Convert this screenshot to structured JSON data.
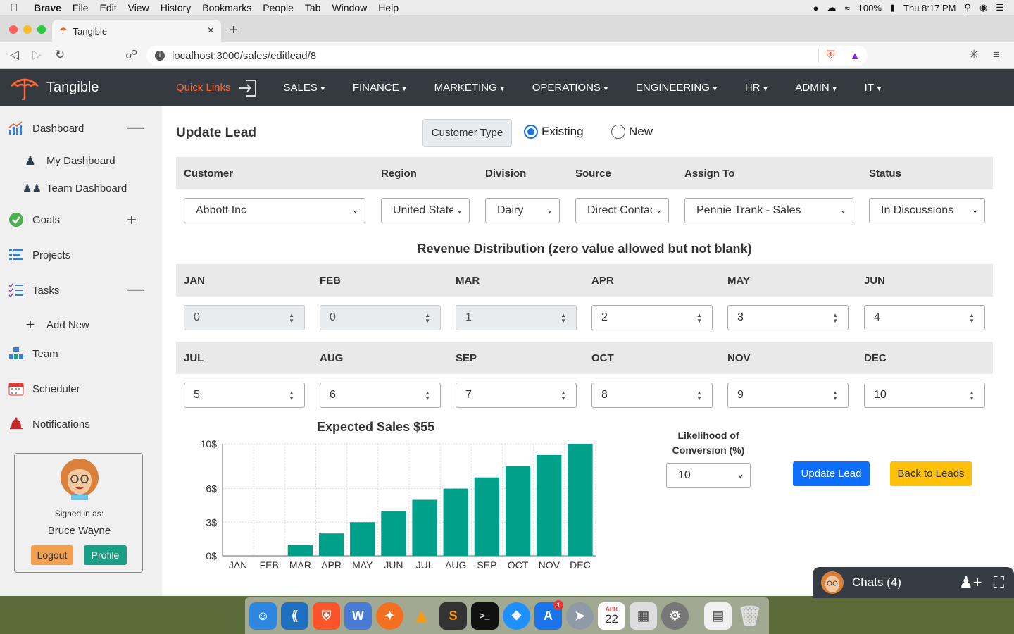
{
  "menubar": {
    "app": "Brave",
    "items": [
      "File",
      "Edit",
      "View",
      "History",
      "Bookmarks",
      "People",
      "Tab",
      "Window",
      "Help"
    ],
    "battery": "100%",
    "clock": "Thu 8:17 PM"
  },
  "browser": {
    "tab_title": "Tangible",
    "url": "localhost:3000/sales/editlead/8"
  },
  "navbar": {
    "brand": "Tangible",
    "quick_links": "Quick Links",
    "links": [
      "SALES",
      "FINANCE",
      "MARKETING",
      "OPERATIONS",
      "ENGINEERING",
      "HR",
      "ADMIN",
      "IT"
    ]
  },
  "sidebar": {
    "dashboard": "Dashboard",
    "my_dashboard": "My Dashboard",
    "team_dashboard": "Team Dashboard",
    "goals": "Goals",
    "projects": "Projects",
    "tasks": "Tasks",
    "add_new": "Add New",
    "team": "Team",
    "scheduler": "Scheduler",
    "notifications": "Notifications",
    "signed_in_as": "Signed in as:",
    "username": "Bruce Wayne",
    "logout": "Logout",
    "profile": "Profile"
  },
  "form": {
    "title": "Update Lead",
    "customer_type_label": "Customer Type",
    "radio_existing": "Existing",
    "radio_new": "New",
    "selected_type": "Existing",
    "headers": {
      "customer": "Customer",
      "region": "Region",
      "division": "Division",
      "source": "Source",
      "assign_to": "Assign To",
      "status": "Status"
    },
    "values": {
      "customer": "Abbott Inc",
      "region": "United States",
      "division": "Dairy",
      "source": "Direct Contact",
      "assign_to": "Pennie Trank - Sales",
      "status": "In Discussions"
    },
    "revenue_title": "Revenue Distribution (zero value allowed but not blank)",
    "months": [
      "JAN",
      "FEB",
      "MAR",
      "APR",
      "MAY",
      "JUN",
      "JUL",
      "AUG",
      "SEP",
      "OCT",
      "NOV",
      "DEC"
    ],
    "revenue": [
      "0",
      "0",
      "1",
      "2",
      "3",
      "4",
      "5",
      "6",
      "7",
      "8",
      "9",
      "10"
    ],
    "likelihood_label_1": "Likelihood of",
    "likelihood_label_2": "Conversion (%)",
    "likelihood_value": "10",
    "update_button": "Update Lead",
    "back_button": "Back to Leads"
  },
  "chart_data": {
    "type": "bar",
    "title": "Expected Sales $55",
    "categories": [
      "JAN",
      "FEB",
      "MAR",
      "APR",
      "MAY",
      "JUN",
      "JUL",
      "AUG",
      "SEP",
      "OCT",
      "NOV",
      "DEC"
    ],
    "values": [
      0,
      0,
      1,
      2,
      3,
      4,
      5,
      6,
      7,
      8,
      9,
      10
    ],
    "yticks": [
      "0$",
      "3$",
      "6$",
      "10$"
    ],
    "ytick_values": [
      0,
      3,
      6,
      10
    ],
    "ylim": [
      0,
      10
    ],
    "grid": true,
    "bar_color": "#00a08a"
  },
  "chat": {
    "label": "Chats (4)"
  },
  "dock": {
    "calendar_month": "APR",
    "calendar_day": "22",
    "appstore_badge": "1"
  },
  "colors": {
    "navbar_bg": "#343a40",
    "accent_orange": "#ff6633",
    "primary": "#0d6efd",
    "warning": "#ffc107",
    "teal": "#1a9e85"
  }
}
